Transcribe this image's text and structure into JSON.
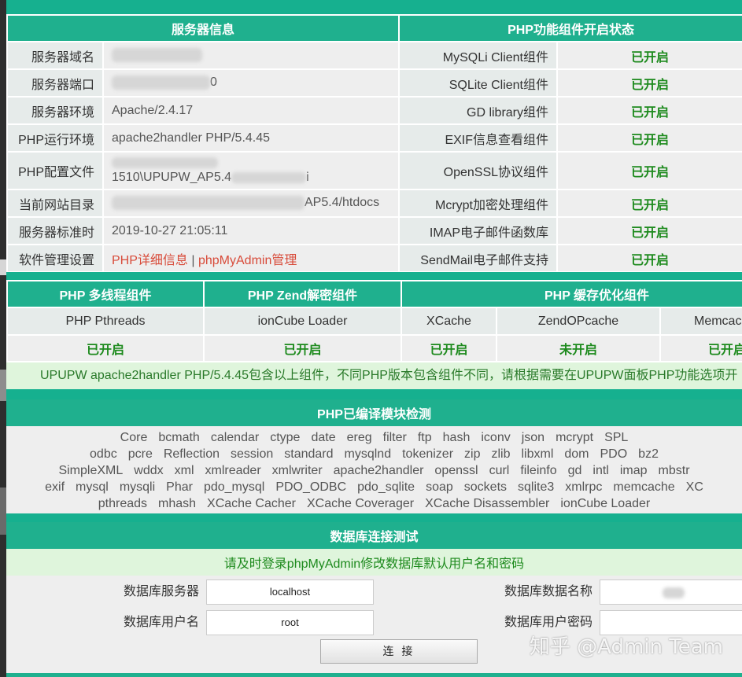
{
  "server": {
    "header": "服务器信息",
    "rows": [
      {
        "label": "服务器域名",
        "value": ""
      },
      {
        "label": "服务器端口",
        "value": "0"
      },
      {
        "label": "服务器环境",
        "value": "Apache/2.4.17"
      },
      {
        "label": "PHP运行环境",
        "value": "apache2handler PHP/5.4.45"
      },
      {
        "label": "PHP配置文件",
        "value": "1510\\UPUPW_AP5.4",
        "value_tail": "i"
      },
      {
        "label": "当前网站目录",
        "value": "AP5.4/htdocs"
      },
      {
        "label": "服务器标准时",
        "value": "2019-10-27 21:05:11"
      },
      {
        "label": "软件管理设置",
        "link1": "PHP详细信息",
        "sep": "|",
        "link2": "phpMyAdmin管理"
      }
    ]
  },
  "components": {
    "header": "PHP功能组件开启状态",
    "rows": [
      {
        "name": "MySQLi Client组件",
        "status": "已开启"
      },
      {
        "name": "SQLite Client组件",
        "status": "已开启"
      },
      {
        "name": "GD library组件",
        "status": "已开启"
      },
      {
        "name": "EXIF信息查看组件",
        "status": "已开启"
      },
      {
        "name": "OpenSSL协议组件",
        "status": "已开启"
      },
      {
        "name": "Mcrypt加密处理组件",
        "status": "已开启"
      },
      {
        "name": "IMAP电子邮件函数库",
        "status": "已开启"
      },
      {
        "name": "SendMail电子邮件支持",
        "status": "已开启"
      }
    ]
  },
  "modules": {
    "headers": [
      "PHP 多线程组件",
      "PHP Zend解密组件",
      "PHP 缓存优化组件"
    ],
    "items": [
      {
        "name": "PHP Pthreads",
        "status": "已开启"
      },
      {
        "name": "ionCube Loader",
        "status": "已开启"
      },
      {
        "name": "XCache",
        "status": "已开启"
      },
      {
        "name": "ZendOPcache",
        "status": "未开启"
      },
      {
        "name": "Memcac",
        "status": "已开启"
      }
    ],
    "note": "UPUPW apache2handler PHP/5.4.45包含以上组件，不同PHP版本包含组件不同，请根据需要在UPUPW面板PHP功能选项开"
  },
  "compiled": {
    "header": "PHP已编译模块检测",
    "lines": [
      [
        "Core",
        "bcmath",
        "calendar",
        "ctype",
        "date",
        "ereg",
        "filter",
        "ftp",
        "hash",
        "iconv",
        "json",
        "mcrypt",
        "SPL"
      ],
      [
        "odbc",
        "pcre",
        "Reflection",
        "session",
        "standard",
        "mysqlnd",
        "tokenizer",
        "zip",
        "zlib",
        "libxml",
        "dom",
        "PDO",
        "bz2"
      ],
      [
        "SimpleXML",
        "wddx",
        "xml",
        "xmlreader",
        "xmlwriter",
        "apache2handler",
        "openssl",
        "curl",
        "fileinfo",
        "gd",
        "intl",
        "imap",
        "mbstr"
      ],
      [
        "exif",
        "mysql",
        "mysqli",
        "Phar",
        "pdo_mysql",
        "PDO_ODBC",
        "pdo_sqlite",
        "soap",
        "sockets",
        "sqlite3",
        "xmlrpc",
        "memcache",
        "XC"
      ],
      [
        "pthreads",
        "mhash",
        "XCache Cacher",
        "XCache Coverager",
        "XCache Disassembler",
        "ionCube Loader"
      ]
    ]
  },
  "db": {
    "header": "数据库连接测试",
    "note": "请及时登录phpMyAdmin修改数据库默认用户名和密码",
    "server_label": "数据库服务器",
    "server_value": "localhost",
    "dbname_label": "数据库数据名称",
    "user_label": "数据库用户名",
    "user_value": "root",
    "pass_label": "数据库用户密码",
    "connect_label": "连 接"
  },
  "watermark": "知乎 @Admin Team",
  "colors": {
    "accent": "#1fb08e",
    "ok": "#1d8a1d",
    "off": "#d84b3a"
  }
}
